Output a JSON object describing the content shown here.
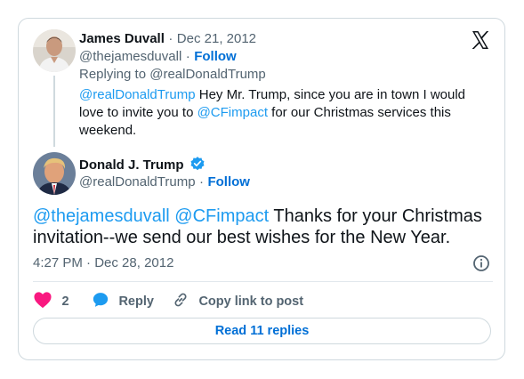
{
  "reply_tweet": {
    "author_name": "James Duvall",
    "date": "Dec 21, 2012",
    "handle": "@thejamesduvall",
    "follow_label": "Follow",
    "replying_to_prefix": "Replying to",
    "replying_to_handle": "@realDonaldTrump",
    "mention": "@realDonaldTrump",
    "text_part1": " Hey Mr. Trump, since you are in town I would love to invite you to ",
    "mention2": "@CFimpact",
    "text_part2": " for our Christmas services this weekend."
  },
  "main_tweet": {
    "author_name": "Donald J. Trump",
    "handle": "@realDonaldTrump",
    "follow_label": "Follow",
    "mention1": "@thejamesduvall",
    "mention2": "@CFimpact",
    "text": "  Thanks for your Christmas invitation--we send our best wishes for the New Year.",
    "time": "4:27 PM",
    "date": "Dec 28, 2012",
    "separator": "·"
  },
  "actions": {
    "like_count": "2",
    "reply_label": "Reply",
    "copy_link_label": "Copy link to post"
  },
  "read_replies_label": "Read 11 replies",
  "colors": {
    "link": "#1d9bf0",
    "follow": "#006fd6",
    "like": "#f91880",
    "reply": "#1d9bf0",
    "verified": "#1d9bf0"
  }
}
